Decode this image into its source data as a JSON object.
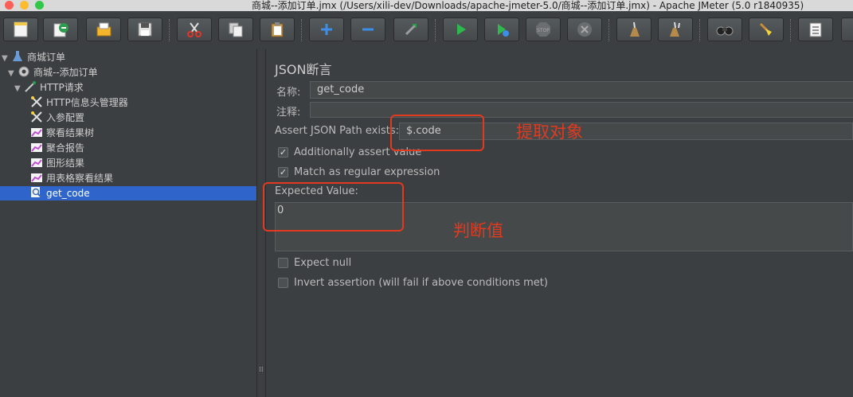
{
  "window": {
    "title": "商城--添加订单.jmx (/Users/xili-dev/Downloads/apache-jmeter-5.0/商城--添加订单.jmx) - Apache JMeter (5.0 r1840935)"
  },
  "colors": {
    "accent": "#2f65ca",
    "annotation": "#e23a1f",
    "background": "#3c3f41"
  },
  "toolbar": {
    "buttons": [
      {
        "name": "new-icon"
      },
      {
        "name": "templates-icon"
      },
      {
        "name": "open-icon"
      },
      {
        "name": "save-icon"
      },
      {
        "name": "cut-icon"
      },
      {
        "name": "copy-icon"
      },
      {
        "name": "paste-icon"
      },
      {
        "name": "expand-icon"
      },
      {
        "name": "collapse-icon"
      },
      {
        "name": "toggle-icon"
      },
      {
        "name": "start-icon"
      },
      {
        "name": "start-no-pause-icon"
      },
      {
        "name": "stop-icon"
      },
      {
        "name": "shutdown-icon"
      },
      {
        "name": "clear-icon"
      },
      {
        "name": "clear-all-icon"
      },
      {
        "name": "search-icon"
      },
      {
        "name": "reset-search-icon"
      },
      {
        "name": "function-helper-icon"
      }
    ]
  },
  "tree": {
    "items": [
      {
        "label": "商城订单",
        "icon": "test-plan-icon"
      },
      {
        "label": "商城--添加订单",
        "icon": "thread-group-icon"
      },
      {
        "label": "HTTP请求",
        "icon": "sampler-icon"
      },
      {
        "label": "HTTP信息头管理器",
        "icon": "config-icon"
      },
      {
        "label": "入参配置",
        "icon": "config-icon"
      },
      {
        "label": "察看结果树",
        "icon": "listener-icon"
      },
      {
        "label": "聚合报告",
        "icon": "listener-icon"
      },
      {
        "label": "图形结果",
        "icon": "listener-icon"
      },
      {
        "label": "用表格察看结果",
        "icon": "listener-icon"
      },
      {
        "label": "get_code",
        "icon": "assertion-icon"
      }
    ]
  },
  "panel": {
    "title": "JSON断言",
    "name_label": "名称:",
    "name_value": "get_code",
    "comment_label": "注释:",
    "comment_value": "",
    "json_path_label": "Assert JSON Path exists:",
    "json_path_value": "$.code",
    "additionally_assert_label": "Additionally assert value",
    "regex_label": "Match as regular expression",
    "expected_label": "Expected Value:",
    "expected_value": "0",
    "expect_null_label": "Expect null",
    "invert_label": "Invert assertion (will fail if above conditions met)"
  },
  "annotations": {
    "extract_object": "提取对象",
    "judge_value": "判断值"
  }
}
